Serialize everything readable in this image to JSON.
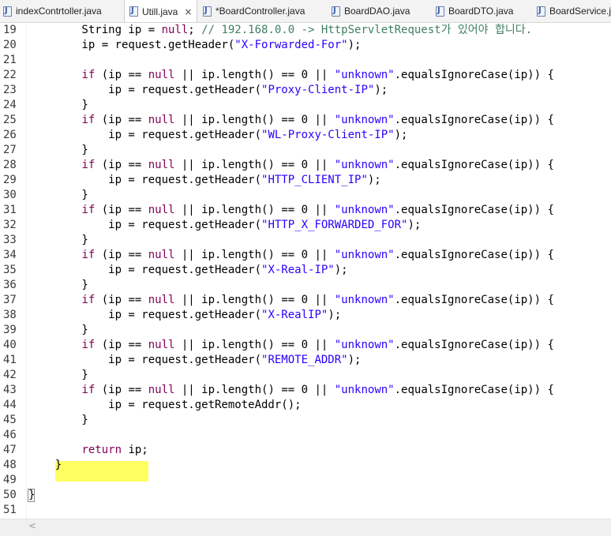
{
  "tabs": [
    {
      "label": "indexContrtoller.java",
      "active": false,
      "closable": false
    },
    {
      "label": "Utill.java",
      "active": true,
      "closable": true
    },
    {
      "label": "*BoardController.java",
      "active": false,
      "closable": false
    },
    {
      "label": "BoardDAO.java",
      "active": false,
      "closable": false
    },
    {
      "label": "BoardDTO.java",
      "active": false,
      "closable": false
    },
    {
      "label": "BoardService.ja",
      "active": false,
      "closable": false
    }
  ],
  "close_glyph": "×",
  "colors": {
    "keyword": "#7f0055",
    "string": "#2a00ff",
    "comment": "#3f7f5f",
    "highlight": "#ffff46"
  },
  "lines": [
    {
      "n": "19",
      "tokens": [
        [
          "p",
          "        String ip = "
        ],
        [
          "k",
          "null"
        ],
        [
          "p",
          "; "
        ],
        [
          "c",
          "// 192.168.0.0 -> HttpServletRequest가 있어야 합니다."
        ]
      ]
    },
    {
      "n": "20",
      "tokens": [
        [
          "p",
          "        ip = request.getHeader("
        ],
        [
          "s",
          "\"X-Forwarded-For\""
        ],
        [
          "p",
          ");"
        ]
      ]
    },
    {
      "n": "21",
      "tokens": []
    },
    {
      "n": "22",
      "tokens": [
        [
          "p",
          "        "
        ],
        [
          "k",
          "if"
        ],
        [
          "p",
          " (ip == "
        ],
        [
          "k",
          "null"
        ],
        [
          "p",
          " || ip.length() == 0 || "
        ],
        [
          "s",
          "\"unknown\""
        ],
        [
          "p",
          ".equalsIgnoreCase(ip)) {"
        ]
      ]
    },
    {
      "n": "23",
      "tokens": [
        [
          "p",
          "            ip = request.getHeader("
        ],
        [
          "s",
          "\"Proxy-Client-IP\""
        ],
        [
          "p",
          ");"
        ]
      ]
    },
    {
      "n": "24",
      "tokens": [
        [
          "p",
          "        }"
        ]
      ]
    },
    {
      "n": "25",
      "tokens": [
        [
          "p",
          "        "
        ],
        [
          "k",
          "if"
        ],
        [
          "p",
          " (ip == "
        ],
        [
          "k",
          "null"
        ],
        [
          "p",
          " || ip.length() == 0 || "
        ],
        [
          "s",
          "\"unknown\""
        ],
        [
          "p",
          ".equalsIgnoreCase(ip)) {"
        ]
      ]
    },
    {
      "n": "26",
      "tokens": [
        [
          "p",
          "            ip = request.getHeader("
        ],
        [
          "s",
          "\"WL-Proxy-Client-IP\""
        ],
        [
          "p",
          ");"
        ]
      ]
    },
    {
      "n": "27",
      "tokens": [
        [
          "p",
          "        }"
        ]
      ]
    },
    {
      "n": "28",
      "tokens": [
        [
          "p",
          "        "
        ],
        [
          "k",
          "if"
        ],
        [
          "p",
          " (ip == "
        ],
        [
          "k",
          "null"
        ],
        [
          "p",
          " || ip.length() == 0 || "
        ],
        [
          "s",
          "\"unknown\""
        ],
        [
          "p",
          ".equalsIgnoreCase(ip)) {"
        ]
      ]
    },
    {
      "n": "29",
      "tokens": [
        [
          "p",
          "            ip = request.getHeader("
        ],
        [
          "s",
          "\"HTTP_CLIENT_IP\""
        ],
        [
          "p",
          ");"
        ]
      ]
    },
    {
      "n": "30",
      "tokens": [
        [
          "p",
          "        }"
        ]
      ]
    },
    {
      "n": "31",
      "tokens": [
        [
          "p",
          "        "
        ],
        [
          "k",
          "if"
        ],
        [
          "p",
          " (ip == "
        ],
        [
          "k",
          "null"
        ],
        [
          "p",
          " || ip.length() == 0 || "
        ],
        [
          "s",
          "\"unknown\""
        ],
        [
          "p",
          ".equalsIgnoreCase(ip)) {"
        ]
      ]
    },
    {
      "n": "32",
      "tokens": [
        [
          "p",
          "            ip = request.getHeader("
        ],
        [
          "s",
          "\"HTTP_X_FORWARDED_FOR\""
        ],
        [
          "p",
          ");"
        ]
      ]
    },
    {
      "n": "33",
      "tokens": [
        [
          "p",
          "        }"
        ]
      ]
    },
    {
      "n": "34",
      "tokens": [
        [
          "p",
          "        "
        ],
        [
          "k",
          "if"
        ],
        [
          "p",
          " (ip == "
        ],
        [
          "k",
          "null"
        ],
        [
          "p",
          " || ip.length() == 0 || "
        ],
        [
          "s",
          "\"unknown\""
        ],
        [
          "p",
          ".equalsIgnoreCase(ip)) {"
        ]
      ]
    },
    {
      "n": "35",
      "tokens": [
        [
          "p",
          "            ip = request.getHeader("
        ],
        [
          "s",
          "\"X-Real-IP\""
        ],
        [
          "p",
          ");"
        ]
      ]
    },
    {
      "n": "36",
      "tokens": [
        [
          "p",
          "        }"
        ]
      ]
    },
    {
      "n": "37",
      "tokens": [
        [
          "p",
          "        "
        ],
        [
          "k",
          "if"
        ],
        [
          "p",
          " (ip == "
        ],
        [
          "k",
          "null"
        ],
        [
          "p",
          " || ip.length() == 0 || "
        ],
        [
          "s",
          "\"unknown\""
        ],
        [
          "p",
          ".equalsIgnoreCase(ip)) {"
        ]
      ]
    },
    {
      "n": "38",
      "tokens": [
        [
          "p",
          "            ip = request.getHeader("
        ],
        [
          "s",
          "\"X-RealIP\""
        ],
        [
          "p",
          ");"
        ]
      ]
    },
    {
      "n": "39",
      "tokens": [
        [
          "p",
          "        }"
        ]
      ]
    },
    {
      "n": "40",
      "tokens": [
        [
          "p",
          "        "
        ],
        [
          "k",
          "if"
        ],
        [
          "p",
          " (ip == "
        ],
        [
          "k",
          "null"
        ],
        [
          "p",
          " || ip.length() == 0 || "
        ],
        [
          "s",
          "\"unknown\""
        ],
        [
          "p",
          ".equalsIgnoreCase(ip)) {"
        ]
      ]
    },
    {
      "n": "41",
      "tokens": [
        [
          "p",
          "            ip = request.getHeader("
        ],
        [
          "s",
          "\"REMOTE_ADDR\""
        ],
        [
          "p",
          ");"
        ]
      ]
    },
    {
      "n": "42",
      "tokens": [
        [
          "p",
          "        }"
        ]
      ]
    },
    {
      "n": "43",
      "tokens": [
        [
          "p",
          "        "
        ],
        [
          "k",
          "if"
        ],
        [
          "p",
          " (ip == "
        ],
        [
          "k",
          "null"
        ],
        [
          "p",
          " || ip.length() == 0 || "
        ],
        [
          "s",
          "\"unknown\""
        ],
        [
          "p",
          ".equalsIgnoreCase(ip)) {"
        ]
      ]
    },
    {
      "n": "44",
      "tokens": [
        [
          "p",
          "            ip = request.getRemoteAddr();"
        ]
      ]
    },
    {
      "n": "45",
      "tokens": [
        [
          "p",
          "        }"
        ]
      ]
    },
    {
      "n": "46",
      "tokens": []
    },
    {
      "n": "47",
      "tokens": [
        [
          "p",
          "        "
        ],
        [
          "k",
          "return"
        ],
        [
          "p",
          " ip;"
        ]
      ]
    },
    {
      "n": "48",
      "tokens": [
        [
          "p",
          "    }"
        ]
      ]
    },
    {
      "n": "49",
      "tokens": []
    },
    {
      "n": "50",
      "tokens": [
        [
          "p",
          "}"
        ]
      ]
    },
    {
      "n": "51",
      "tokens": []
    }
  ],
  "scrollbar": {
    "left_arrow": "<"
  }
}
